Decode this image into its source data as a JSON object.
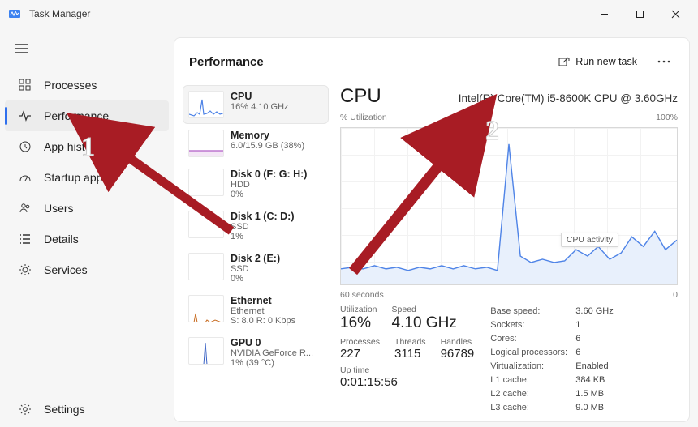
{
  "window": {
    "title": "Task Manager"
  },
  "nav": {
    "processes": "Processes",
    "performance": "Performance",
    "app_history": "App history",
    "startup_apps": "Startup apps",
    "users": "Users",
    "details": "Details",
    "services": "Services",
    "settings": "Settings"
  },
  "header": {
    "title": "Performance",
    "run_task": "Run new task"
  },
  "perf_list": [
    {
      "name": "CPU",
      "sub": "16%  4.10 GHz"
    },
    {
      "name": "Memory",
      "sub": "6.0/15.9 GB (38%)"
    },
    {
      "name": "Disk 0 (F: G: H:)",
      "sub": "HDD",
      "sub2": "0%"
    },
    {
      "name": "Disk 1 (C: D:)",
      "sub": "SSD",
      "sub2": "1%"
    },
    {
      "name": "Disk 2 (E:)",
      "sub": "SSD",
      "sub2": "0%"
    },
    {
      "name": "Ethernet",
      "sub": "Ethernet",
      "sub2": "S: 8.0  R: 0 Kbps"
    },
    {
      "name": "GPU 0",
      "sub": "NVIDIA GeForce R...",
      "sub2": "1% (39 °C)"
    }
  ],
  "detail": {
    "title": "CPU",
    "model": "Intel(R) Core(TM) i5-8600K CPU @ 3.60GHz",
    "axis_left": "% Utilization",
    "axis_right": "100%",
    "axis_bl": "60 seconds",
    "axis_br": "0",
    "tooltip": "CPU activity",
    "util_lbl": "Utilization",
    "util_val": "16%",
    "speed_lbl": "Speed",
    "speed_val": "4.10 GHz",
    "proc_lbl": "Processes",
    "proc_val": "227",
    "thr_lbl": "Threads",
    "thr_val": "3115",
    "hnd_lbl": "Handles",
    "hnd_val": "96789",
    "up_lbl": "Up time",
    "up_val": "0:01:15:56",
    "specs": {
      "base_k": "Base speed:",
      "base_v": "3.60 GHz",
      "sock_k": "Sockets:",
      "sock_v": "1",
      "core_k": "Cores:",
      "core_v": "6",
      "lp_k": "Logical processors:",
      "lp_v": "6",
      "virt_k": "Virtualization:",
      "virt_v": "Enabled",
      "l1_k": "L1 cache:",
      "l1_v": "384 KB",
      "l2_k": "L2 cache:",
      "l2_v": "1.5 MB",
      "l3_k": "L3 cache:",
      "l3_v": "9.0 MB"
    }
  },
  "chart_data": {
    "type": "line",
    "title": "% Utilization",
    "xlabel": "60 seconds",
    "ylabel": "% Utilization",
    "ylim": [
      0,
      100
    ],
    "x": [
      0,
      2,
      4,
      6,
      8,
      10,
      12,
      14,
      16,
      18,
      20,
      22,
      24,
      26,
      28,
      30,
      32,
      34,
      36,
      38,
      40,
      42,
      44,
      46,
      48,
      50,
      52,
      54,
      56,
      58,
      60
    ],
    "values": [
      10,
      11,
      10,
      12,
      10,
      11,
      9,
      11,
      10,
      12,
      10,
      12,
      10,
      11,
      9,
      90,
      18,
      14,
      16,
      14,
      15,
      22,
      18,
      24,
      16,
      20,
      30,
      24,
      34,
      22,
      28
    ]
  },
  "annotations": {
    "one": "1",
    "two": "2"
  },
  "colors": {
    "accent": "#4f84e7",
    "annotation": "#a81c24"
  }
}
